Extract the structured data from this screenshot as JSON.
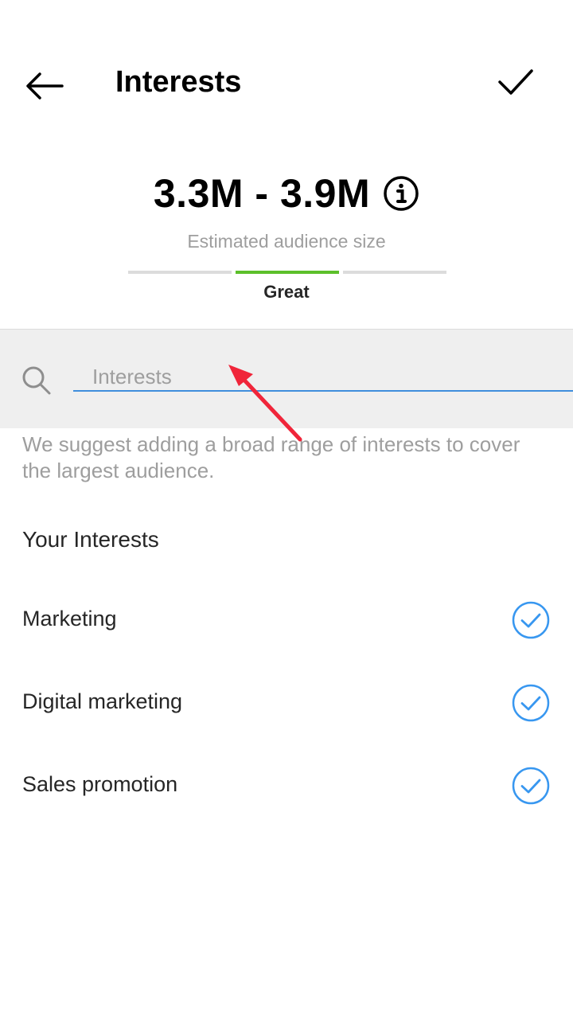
{
  "header": {
    "title": "Interests",
    "back_icon": "arrow-left-icon",
    "done_icon": "checkmark-icon"
  },
  "audience": {
    "range": "3.3M - 3.9M",
    "label": "Estimated audience size",
    "meter_label": "Great",
    "meter_active_segment": 2,
    "meter_segments": 3,
    "info_icon": "info-icon"
  },
  "search": {
    "placeholder": "Interests",
    "value": "",
    "icon": "search-icon"
  },
  "hint": "We suggest adding a broad range of interests to cover the largest audience.",
  "interests": {
    "section_title": "Your Interests",
    "items": [
      {
        "label": "Marketing",
        "selected": true
      },
      {
        "label": "Digital marketing",
        "selected": true
      },
      {
        "label": "Sales promotion",
        "selected": true
      }
    ]
  },
  "colors": {
    "accent": "#3897F0",
    "meter_active": "#5CBF2A",
    "annotation": "#F0253A"
  }
}
